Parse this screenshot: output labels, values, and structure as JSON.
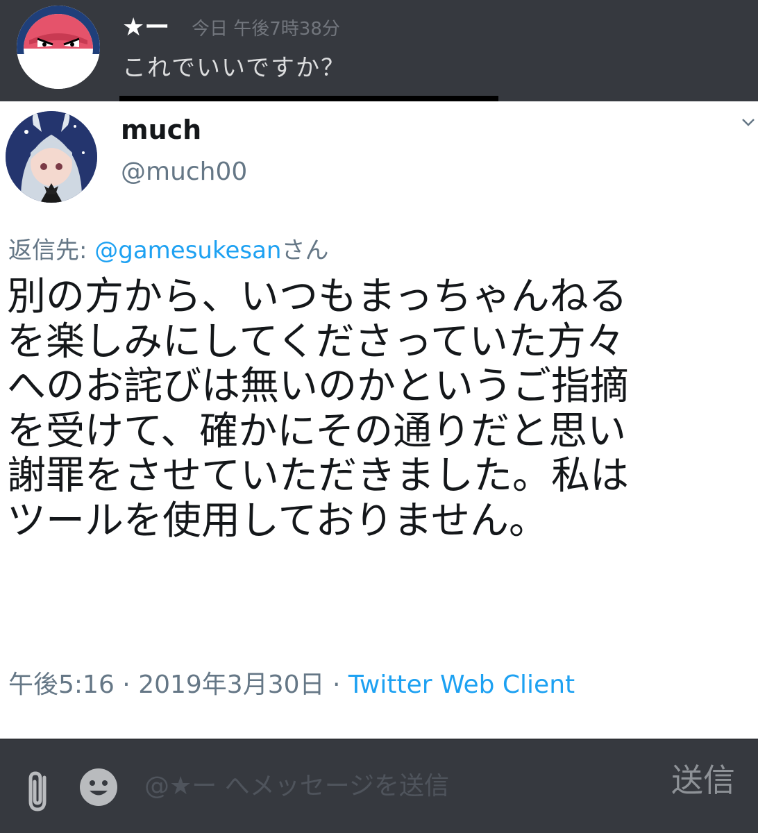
{
  "chat": {
    "author": "★ー",
    "timestamp": "今日 午後7時38分",
    "text": "これでいいですか？",
    "avatar_icon": "voltorb-avatar-icon"
  },
  "tweet": {
    "display_name": "much",
    "handle": "@much00",
    "reply_prefix": "返信先: ",
    "reply_mention": "@gamesukesan",
    "reply_suffix": "さん",
    "body": "別の方から、いつもまっちゃんねる\nを楽しみにしてくださっていた方々\nへのお詫びは無いのかというご指摘\nを受けて、確かにその通りだと思い\n謝罪をさせていただきました。私は\nツールを使用しておりません。",
    "time": "午後5:16",
    "separator": " · ",
    "date": "2019年3月30日",
    "client": "Twitter Web Client",
    "colors": {
      "link": "#1da1f2",
      "muted": "#657786",
      "text": "#14171a"
    }
  },
  "composer": {
    "placeholder": "@★ー へメッセージを送信",
    "send_label": "送信"
  },
  "colors": {
    "background": "#36393f",
    "chat_text": "#dcddde",
    "timestamp": "#72767d"
  }
}
